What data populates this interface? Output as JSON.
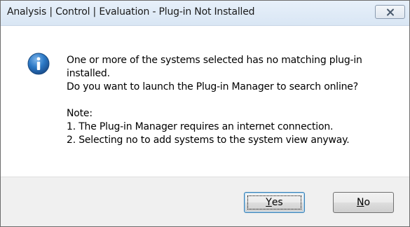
{
  "window": {
    "title": "Analysis | Control | Evaluation - Plug-in Not Installed"
  },
  "icons": {
    "info": "info-icon",
    "close": "close-icon"
  },
  "message": {
    "line1": "One or more of the systems selected has no matching plug-in",
    "line2": "installed.",
    "line3": "Do you want to launch the Plug-in Manager to search online?",
    "note_heading": "Note:",
    "note1": "1. The Plug-in Manager requires an internet connection.",
    "note2": "2. Selecting no to add systems to the system view anyway."
  },
  "buttons": {
    "yes": {
      "mnemonic": "Y",
      "rest": "es"
    },
    "no": {
      "mnemonic": "N",
      "rest": "o"
    }
  },
  "colors": {
    "info_blue": "#2b78c5",
    "titlebar": "#dfe9f5",
    "footer": "#f0f0f0"
  }
}
